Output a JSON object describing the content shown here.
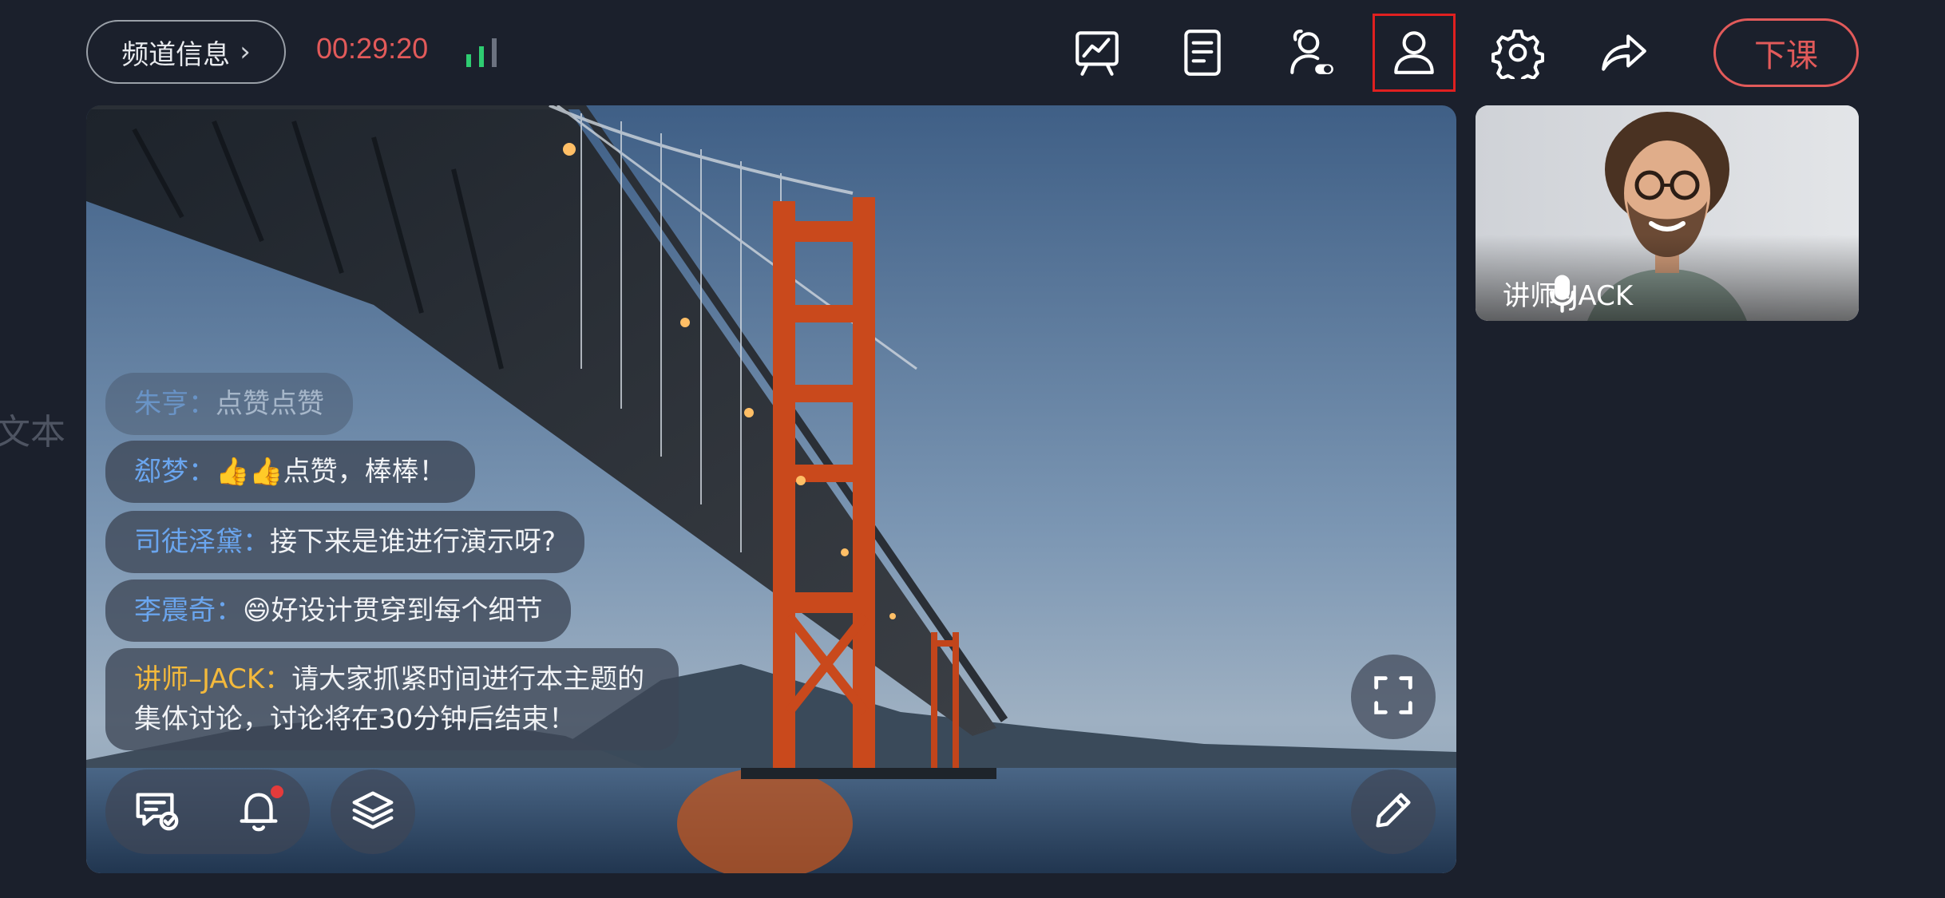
{
  "topbar": {
    "channel_label": "频道信息",
    "channel_chevron": "›",
    "timer": "00:29:20",
    "signal_icon": "signal-bars-icon",
    "tools": [
      {
        "name": "whiteboard-chart-icon"
      },
      {
        "name": "document-icon"
      },
      {
        "name": "student-toggle-icon"
      },
      {
        "name": "user-icon",
        "selected": true
      },
      {
        "name": "gear-icon"
      },
      {
        "name": "share-icon"
      }
    ],
    "end_class_label": "下课"
  },
  "side_label": "文本",
  "chat": [
    {
      "nick": "朱亨：",
      "text": "点赞点赞",
      "faded": true
    },
    {
      "nick": "郄梦：",
      "emoji": "👍👍",
      "text": "点赞，棒棒！"
    },
    {
      "nick": "司徒泽黛：",
      "text": "接下来是谁进行演示呀?"
    },
    {
      "nick": "李震奇：",
      "emoji": "😄",
      "text": "好设计贯穿到每个细节"
    },
    {
      "nick": "讲师–JACK：",
      "text": "请大家抓紧时间进行本主题的集体讨论，讨论将在30分钟后结束！",
      "teacher": true
    }
  ],
  "teacher_video": {
    "name": "讲师–JACK",
    "mic_icon": "microphone-icon"
  },
  "colors": {
    "background": "#1b202c",
    "accent_red": "#e25a5a",
    "nick_blue": "#6aa5ee",
    "teacher_gold": "#f3b93c",
    "signal_green": "#2ecc71"
  }
}
